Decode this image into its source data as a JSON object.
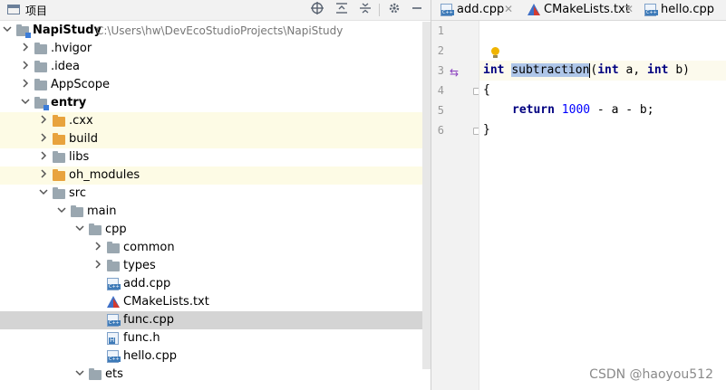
{
  "project_panel": {
    "title": "项目",
    "header_icons": [
      "crosshair-icon",
      "collapse-all-icon",
      "expand-all-icon",
      "gear-icon",
      "minimize-icon"
    ]
  },
  "tree": [
    {
      "label": "NapiStudy",
      "path": "C:\\Users\\hw\\DevEcoStudioProjects\\NapiStudy",
      "depth": 0,
      "expanded": true,
      "icon": "module-folder",
      "bold": true,
      "highlight": ""
    },
    {
      "label": ".hvigor",
      "depth": 1,
      "expanded": false,
      "icon": "folder",
      "highlight": ""
    },
    {
      "label": ".idea",
      "depth": 1,
      "expanded": false,
      "icon": "folder",
      "highlight": ""
    },
    {
      "label": "AppScope",
      "depth": 1,
      "expanded": false,
      "icon": "folder",
      "highlight": ""
    },
    {
      "label": "entry",
      "depth": 1,
      "expanded": true,
      "icon": "module-folder",
      "bold": true,
      "highlight": ""
    },
    {
      "label": ".cxx",
      "depth": 2,
      "expanded": false,
      "icon": "orange-folder",
      "highlight": "yellow"
    },
    {
      "label": "build",
      "depth": 2,
      "expanded": false,
      "icon": "orange-folder",
      "highlight": "yellow"
    },
    {
      "label": "libs",
      "depth": 2,
      "expanded": false,
      "icon": "folder",
      "highlight": ""
    },
    {
      "label": "oh_modules",
      "depth": 2,
      "expanded": false,
      "icon": "orange-folder",
      "highlight": "yellow"
    },
    {
      "label": "src",
      "depth": 2,
      "expanded": true,
      "icon": "folder",
      "highlight": ""
    },
    {
      "label": "main",
      "depth": 3,
      "expanded": true,
      "icon": "folder",
      "highlight": ""
    },
    {
      "label": "cpp",
      "depth": 4,
      "expanded": true,
      "icon": "folder",
      "highlight": ""
    },
    {
      "label": "common",
      "depth": 5,
      "expanded": false,
      "icon": "folder",
      "highlight": ""
    },
    {
      "label": "types",
      "depth": 5,
      "expanded": false,
      "icon": "folder",
      "highlight": ""
    },
    {
      "label": "add.cpp",
      "depth": 5,
      "icon": "cpp-file",
      "highlight": ""
    },
    {
      "label": "CMakeLists.txt",
      "depth": 5,
      "icon": "cmake-file",
      "highlight": ""
    },
    {
      "label": "func.cpp",
      "depth": 5,
      "icon": "cpp-file",
      "highlight": "selected"
    },
    {
      "label": "func.h",
      "depth": 5,
      "icon": "h-file",
      "highlight": ""
    },
    {
      "label": "hello.cpp",
      "depth": 5,
      "icon": "cpp-file",
      "highlight": ""
    },
    {
      "label": "ets",
      "depth": 4,
      "expanded": true,
      "icon": "folder",
      "highlight": ""
    }
  ],
  "editor": {
    "tabs": [
      {
        "label": "add.cpp",
        "icon": "cpp-file"
      },
      {
        "label": "CMakeLists.txt",
        "icon": "cmake-file"
      },
      {
        "label": "hello.cpp",
        "icon": "cpp-file"
      }
    ],
    "line_numbers": [
      "1",
      "2",
      "3",
      "4",
      "5",
      "6"
    ],
    "code": {
      "line3": {
        "kw1": "int",
        "fname": "subtraction",
        "p1": "(",
        "kw2": "int",
        "p2": " a, ",
        "kw3": "int",
        "p3": " b)"
      },
      "line4": "{",
      "line5": {
        "kw": "return",
        "num": "1000",
        "rest": " - a - b;"
      },
      "line6": "}"
    }
  },
  "watermark": "CSDN @haoyou512"
}
